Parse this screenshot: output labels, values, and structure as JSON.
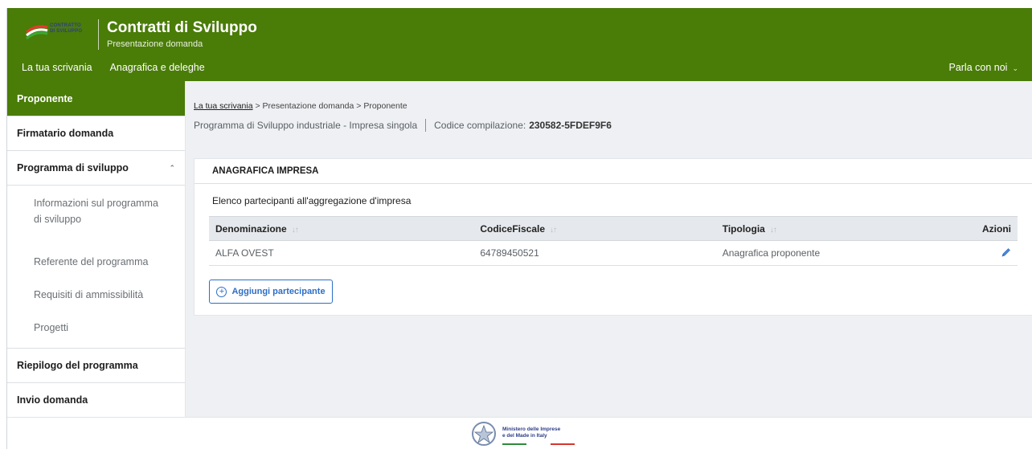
{
  "header": {
    "logo_lines": [
      "CONTRATTO",
      "DI SVILUPPO"
    ],
    "title": "Contratti di Sviluppo",
    "subtitle": "Presentazione domanda",
    "nav": [
      "La tua scrivania",
      "Anagrafica e deleghe"
    ],
    "contact": "Parla con noi"
  },
  "sidebar": {
    "items": [
      {
        "label": "Proponente"
      },
      {
        "label": "Firmatario domanda"
      },
      {
        "label": "Programma di sviluppo"
      },
      {
        "label": "Riepilogo del programma"
      },
      {
        "label": "Invio domanda"
      }
    ],
    "subitems": [
      "Informazioni sul programma di sviluppo",
      "Referente del programma",
      "Requisiti di ammissibilità",
      "Progetti"
    ]
  },
  "breadcrumb": {
    "home": "La tua scrivania",
    "rest": "> Presentazione domanda > Proponente"
  },
  "meta": {
    "program": "Programma di Sviluppo industriale - Impresa singola",
    "code_label": "Codice compilazione:",
    "code": "230582-5FDEF9F6"
  },
  "card": {
    "title": "ANAGRAFICA IMPRESA",
    "subtitle": "Elenco partecipanti all'aggregazione d'impresa",
    "columns": [
      "Denominazione",
      "CodiceFiscale",
      "Tipologia",
      "Azioni"
    ],
    "rows": [
      {
        "denominazione": "ALFA OVEST",
        "codice_fiscale": "64789450521",
        "tipologia": "Anagrafica proponente"
      }
    ],
    "add_button": "Aggiungi partecipante"
  },
  "footer": {
    "ministry_lines": [
      "Ministero delle Imprese",
      "e del Made in Italy"
    ]
  },
  "colors": {
    "brand_green": "#4a7c08",
    "link_blue": "#2d6ec7",
    "main_bg": "#eef0f3"
  },
  "icons": {
    "sort": "sort-arrows-icon",
    "edit": "pencil-icon",
    "add": "plus-circle-icon",
    "chevron": "chevron-icon"
  }
}
